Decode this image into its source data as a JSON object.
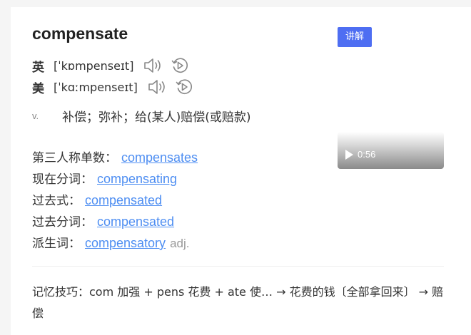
{
  "entry": {
    "word": "compensate",
    "explain_button": "讲解"
  },
  "pronunciations": [
    {
      "region": "英",
      "ipa": "[ˈkɒmpenseɪt]"
    },
    {
      "region": "美",
      "ipa": "[ˈkɑːmpenseɪt]"
    }
  ],
  "definition": {
    "pos": "v.",
    "meaning": "补偿；弥补；给(某人)赔偿(或赔款)"
  },
  "video": {
    "duration": "0:56"
  },
  "forms": [
    {
      "label": "第三人称单数：",
      "value": "compensates",
      "suffix": ""
    },
    {
      "label": "现在分词：",
      "value": "compensating",
      "suffix": ""
    },
    {
      "label": "过去式：",
      "value": "compensated",
      "suffix": ""
    },
    {
      "label": "过去分词：",
      "value": "compensated",
      "suffix": ""
    },
    {
      "label": "派生词：",
      "value": "compensatory",
      "suffix": "adj."
    }
  ],
  "mnemonic": {
    "text": "记忆技巧：com 加强 + pens 花费 + ate 使… → 花费的钱〔全部拿回来〕 → 赔偿"
  },
  "colors": {
    "accent": "#4e6ef2",
    "link": "#4e8ef2"
  }
}
